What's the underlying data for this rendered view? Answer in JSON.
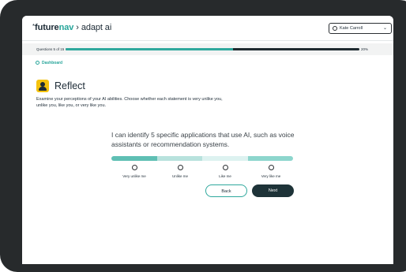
{
  "header": {
    "logo_star": "*",
    "logo_future": "future",
    "logo_nav": "nav",
    "separator": "›",
    "app_name": "adapt ai",
    "user_name": "Kate Carroll"
  },
  "progress": {
    "label": "Questions 5 of 15",
    "percent_text": "20%",
    "fill_fraction": 0.57
  },
  "nav": {
    "dashboard_label": "Dashboard"
  },
  "section": {
    "title": "Reflect",
    "instructions": "Examine your perceptions of your AI abilities. Choose whether each statement is very unlike you, unlike you, like you, or very like you."
  },
  "question": {
    "statement": "I can identify 5 specific applications that use AI, such as voice assistants or recommendation systems.",
    "options": [
      "Very unlike me",
      "Unlike me",
      "Like me",
      "Very like me"
    ]
  },
  "buttons": {
    "back": "Back",
    "next": "Next"
  },
  "colors": {
    "accent": "#2fa89d",
    "brand_dark": "#1d2b36",
    "icon_yellow": "#f4c20d",
    "next_button": "#1e3338"
  },
  "icons": {
    "reflect": "person-icon",
    "user": "user-circle-icon",
    "dashboard": "circle-arrow-icon",
    "chevron": "chevron-down-icon"
  }
}
